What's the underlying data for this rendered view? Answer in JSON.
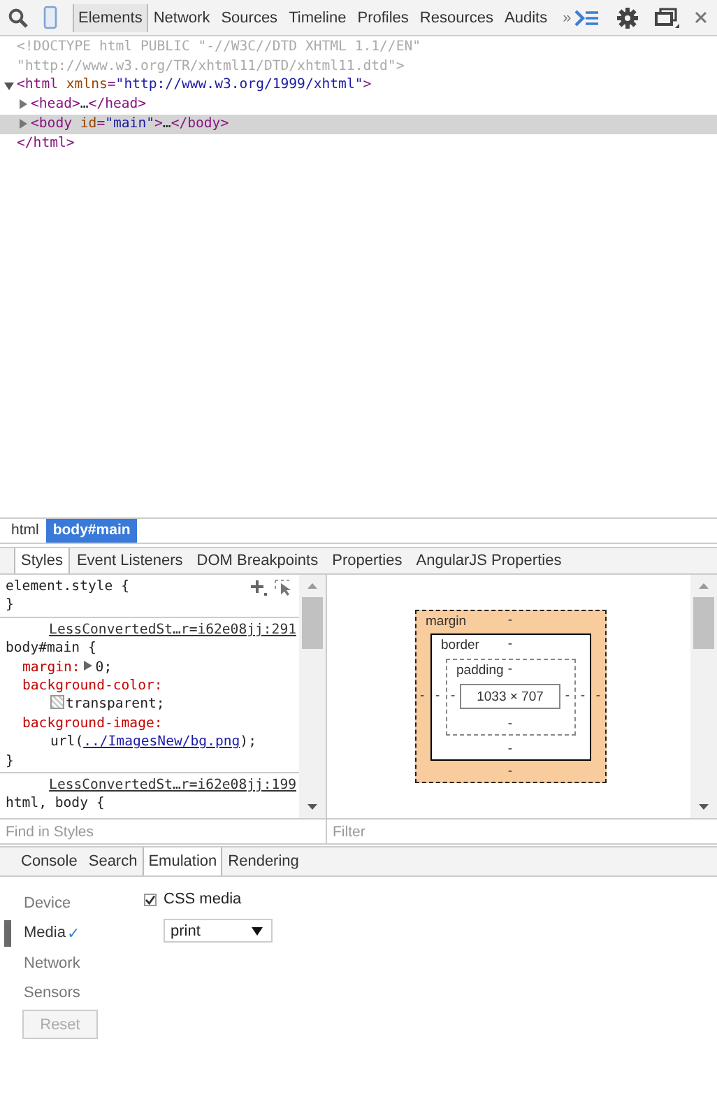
{
  "toolbar": {
    "tabs": [
      {
        "label": "Elements",
        "selected": true
      },
      {
        "label": "Network",
        "selected": false
      },
      {
        "label": "Sources",
        "selected": false
      },
      {
        "label": "Timeline",
        "selected": false
      },
      {
        "label": "Profiles",
        "selected": false
      },
      {
        "label": "Resources",
        "selected": false
      },
      {
        "label": "Audits",
        "selected": false
      }
    ],
    "overflow": "»"
  },
  "dom_tree": [
    {
      "tokens": [
        {
          "kind": "doctype",
          "text": "<!DOCTYPE html PUBLIC \"-//W3C//DTD XHTML 1.1//EN\" \"http://www.w3.org/TR/xhtml11/DTD/xhtml11.dtd\">"
        }
      ],
      "selected": false
    },
    {
      "tokens": [
        {
          "kind": "tag",
          "text": "<html"
        },
        {
          "kind": "attr",
          "text": " xmlns"
        },
        {
          "kind": "tag",
          "text": "="
        },
        {
          "kind": "value",
          "text": "\"http://www.w3.org/1999/xhtml\""
        },
        {
          "kind": "tag",
          "text": ">"
        }
      ],
      "expanded": true,
      "selected": false,
      "children": [
        {
          "tokens": [
            {
              "kind": "tag",
              "text": "<head>"
            },
            {
              "kind": "plain",
              "text": "…"
            },
            {
              "kind": "tag",
              "text": "</head>"
            }
          ],
          "expanded": false,
          "selected": false
        },
        {
          "tokens": [
            {
              "kind": "tag",
              "text": "<body"
            },
            {
              "kind": "attr",
              "text": " id"
            },
            {
              "kind": "tag",
              "text": "="
            },
            {
              "kind": "value",
              "text": "\"main\""
            },
            {
              "kind": "tag",
              "text": ">"
            },
            {
              "kind": "plain",
              "text": "…"
            },
            {
              "kind": "tag",
              "text": "</body>"
            }
          ],
          "expanded": false,
          "selected": true
        }
      ]
    },
    {
      "tokens": [
        {
          "kind": "tag",
          "text": "</html>"
        }
      ],
      "selected": false
    }
  ],
  "breadcrumbs": [
    {
      "label": "html",
      "selected": false
    },
    {
      "label": "body#main",
      "selected": true
    }
  ],
  "sidebar_tabs": [
    {
      "label": "Styles",
      "selected": true
    },
    {
      "label": "Event Listeners",
      "selected": false
    },
    {
      "label": "DOM Breakpoints",
      "selected": false
    },
    {
      "label": "Properties",
      "selected": false
    },
    {
      "label": "AngularJS Properties",
      "selected": false
    }
  ],
  "style_rules": [
    {
      "kind": "inline",
      "selector": "element.style {",
      "close": "}"
    },
    {
      "kind": "sheet",
      "source": "LessConvertedSt…r=i62e08jj:291",
      "selector": "body#main {",
      "close": "}",
      "declarations": [
        {
          "name": "margin:",
          "value": "0;",
          "kind": "shorthand"
        },
        {
          "name": "background-color:",
          "value": "transparent;",
          "kind": "color"
        },
        {
          "name": "background-image:",
          "value": "url(",
          "link": "../ImagesNew/bg.png",
          "value_end": ");",
          "kind": "url"
        }
      ]
    },
    {
      "kind": "sheet",
      "source": "LessConvertedSt…r=i62e08jj:199",
      "selector": "html, body {"
    }
  ],
  "metrics": {
    "margin": {
      "label": "margin",
      "top": "-",
      "right": "-",
      "bottom": "-",
      "left": "-"
    },
    "border": {
      "label": "border",
      "top": "-",
      "right": "-",
      "bottom": "-",
      "left": "-"
    },
    "padding": {
      "label": "padding",
      "top": "-",
      "right": "-",
      "bottom": "-",
      "left": "-"
    },
    "content": "1033 × 707"
  },
  "styles_filter": {
    "placeholder": "Find in Styles"
  },
  "metrics_filter": {
    "placeholder": "Filter"
  },
  "drawer_tabs": [
    {
      "label": "Console",
      "selected": false
    },
    {
      "label": "Search",
      "selected": false
    },
    {
      "label": "Emulation",
      "selected": true
    },
    {
      "label": "Rendering",
      "selected": false
    }
  ],
  "emulation": {
    "sections": [
      {
        "label": "Device",
        "selected": false
      },
      {
        "label": "Media",
        "selected": true,
        "mark": "✓"
      },
      {
        "label": "Network",
        "selected": false
      },
      {
        "label": "Sensors",
        "selected": false
      }
    ],
    "reset": {
      "label": "Reset",
      "disabled": true
    },
    "css_media": {
      "label": "CSS media",
      "checked": true
    },
    "media_type": {
      "value": "print"
    }
  }
}
